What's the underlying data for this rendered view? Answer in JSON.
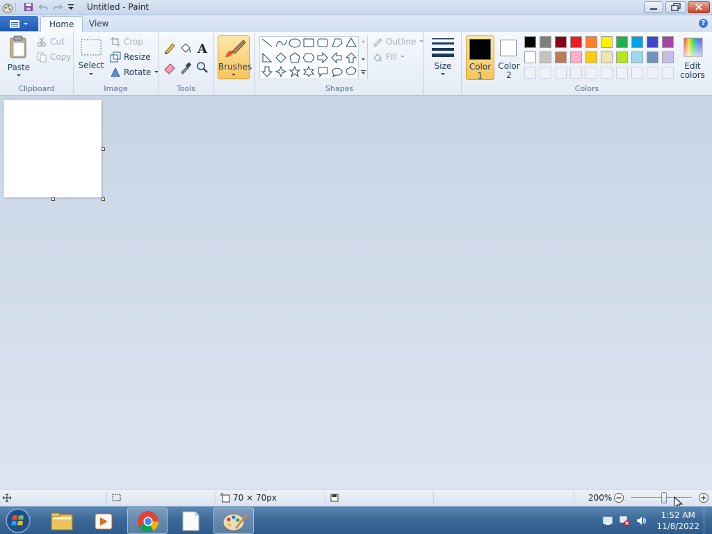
{
  "window": {
    "title": "Untitled - Paint"
  },
  "tabs": {
    "home": "Home",
    "view": "View"
  },
  "clipboard": {
    "paste": "Paste",
    "cut": "Cut",
    "copy": "Copy",
    "label": "Clipboard"
  },
  "image": {
    "select": "Select",
    "crop": "Crop",
    "resize": "Resize",
    "rotate": "Rotate",
    "label": "Image"
  },
  "tools": {
    "label": "Tools"
  },
  "brushes": {
    "label": "Brushes"
  },
  "shapes": {
    "outline": "Outline",
    "fill": "Fill",
    "label": "Shapes"
  },
  "size": {
    "label": "Size"
  },
  "colors": {
    "color1_line1": "Color",
    "color1_line2": "1",
    "color2_line1": "Color",
    "color2_line2": "2",
    "edit_line1": "Edit",
    "edit_line2": "colors",
    "label": "Colors",
    "color1_value": "#000000",
    "color2_value": "#ffffff",
    "palette_row1": [
      "#000000",
      "#7f7f7f",
      "#880015",
      "#ed1c24",
      "#ff7f27",
      "#fff200",
      "#22b14c",
      "#00a2e8",
      "#3f48cc",
      "#a349a4"
    ],
    "palette_row2": [
      "#ffffff",
      "#c3c3c3",
      "#b97a57",
      "#ffaec9",
      "#ffc90e",
      "#efe4b0",
      "#b5e61d",
      "#99d9ea",
      "#7092be",
      "#c8bfe7"
    ]
  },
  "status": {
    "canvas_size": "70 × 70px",
    "zoom": "200%"
  },
  "taskbar": {
    "time": "1:52 AM",
    "date": "11/8/2022"
  }
}
